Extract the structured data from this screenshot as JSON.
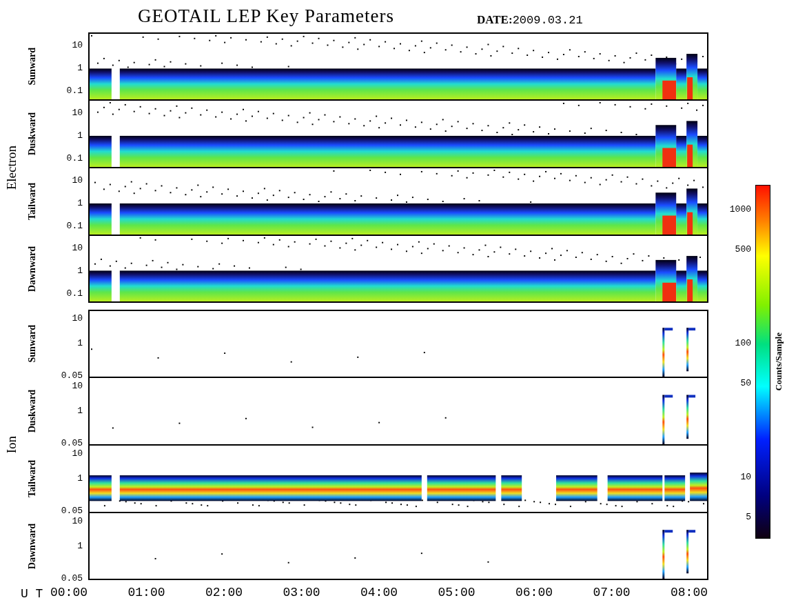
{
  "title": "GEOTAIL LEP Key Parameters",
  "date": {
    "label": "DATE:",
    "value": "2009.03.21"
  },
  "groups": [
    {
      "name": "Electron",
      "panels": [
        {
          "direction": "Sunward",
          "kind": "electron",
          "yticks": [
            "10",
            "1",
            "0.1"
          ]
        },
        {
          "direction": "Duskward",
          "kind": "electron",
          "yticks": [
            "10",
            "1",
            "0.1"
          ]
        },
        {
          "direction": "Tailward",
          "kind": "electron",
          "yticks": [
            "10",
            "1",
            "0.1"
          ]
        },
        {
          "direction": "Dawnward",
          "kind": "electron",
          "yticks": [
            "10",
            "1",
            "0.1"
          ]
        }
      ]
    },
    {
      "name": "Ion",
      "panels": [
        {
          "direction": "Sunward",
          "kind": "ion-burst",
          "yticks": [
            "10",
            "1",
            "0.05"
          ]
        },
        {
          "direction": "Duskward",
          "kind": "ion-burst",
          "yticks": [
            "10",
            "1",
            "0.05"
          ]
        },
        {
          "direction": "Tailward",
          "kind": "ion-band",
          "yticks": [
            "10",
            "1",
            "0.05"
          ]
        },
        {
          "direction": "Dawnward",
          "kind": "ion-burst",
          "yticks": [
            "10",
            "1",
            "0.05"
          ]
        }
      ]
    }
  ],
  "time_axis": {
    "label": "U T",
    "ticks": [
      "00:00",
      "01:00",
      "02:00",
      "03:00",
      "04:00",
      "05:00",
      "06:00",
      "07:00",
      "08:00"
    ]
  },
  "colorbar": {
    "title": "Counts/Sample",
    "ticks": [
      "1000",
      "500",
      "100",
      "50",
      "10",
      "5"
    ]
  }
}
